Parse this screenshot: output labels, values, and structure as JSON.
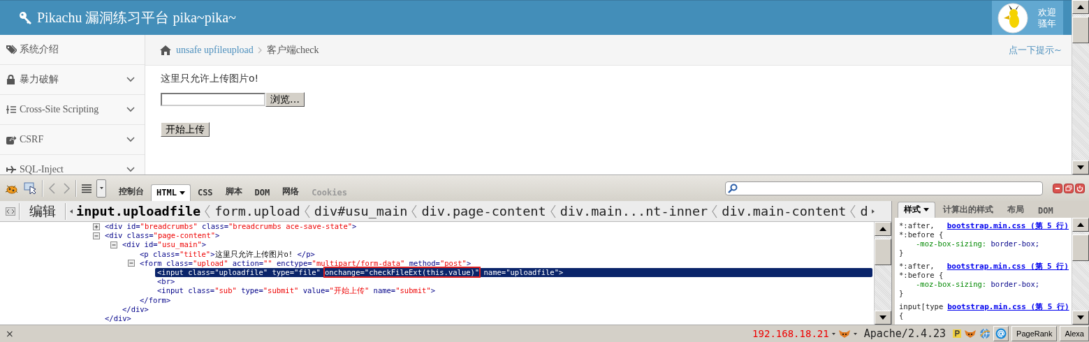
{
  "header": {
    "title": "Pikachu 漏洞练习平台 pika~pika~",
    "greeting": [
      "欢迎",
      "骚年"
    ]
  },
  "sidebar": {
    "items": [
      {
        "label": "系统介绍",
        "has_submenu": false
      },
      {
        "label": "暴力破解",
        "has_submenu": true
      },
      {
        "label": "Cross-Site Scripting",
        "has_submenu": true
      },
      {
        "label": "CSRF",
        "has_submenu": true
      },
      {
        "label": "SQL-Inject",
        "has_submenu": true
      }
    ]
  },
  "breadcrumb": {
    "items": [
      {
        "text": "unsafe upfileupload",
        "kind": "link"
      },
      {
        "text": "客户端check",
        "kind": "current"
      }
    ],
    "hint": "点一下提示~"
  },
  "content": {
    "title": "这里只允许上传图片o!",
    "browse_button": "浏览…",
    "submit_button": "开始上传"
  },
  "firebug": {
    "tabs": [
      {
        "label": "控制台",
        "selected": false,
        "disabled": false
      },
      {
        "label": "HTML",
        "selected": true,
        "disabled": false
      },
      {
        "label": "CSS",
        "selected": false,
        "disabled": false
      },
      {
        "label": "脚本",
        "selected": false,
        "disabled": false
      },
      {
        "label": "DOM",
        "selected": false,
        "disabled": false
      },
      {
        "label": "网络",
        "selected": false,
        "disabled": false
      },
      {
        "label": "Cookies",
        "selected": false,
        "disabled": true
      }
    ],
    "edit_button": "编辑",
    "path": [
      {
        "text": "input.uploadfile",
        "selected": true
      },
      {
        "text": "form.upload",
        "selected": false
      },
      {
        "text": "div#usu_main",
        "selected": false
      },
      {
        "text": "div.page-content",
        "selected": false
      },
      {
        "text": "div.main...nt-inner",
        "selected": false
      },
      {
        "text": "div.main-content",
        "selected": false
      },
      {
        "text": "d",
        "selected": false
      }
    ],
    "html_lines": [
      {
        "selected": false,
        "expanded": false,
        "tokens": [
          {
            "kind": "tag",
            "text": "<div"
          },
          {
            "kind": "attr",
            "text": " id="
          },
          {
            "kind": "value",
            "text": "\"breadcrumbs\""
          },
          {
            "kind": "attr",
            "text": " class="
          },
          {
            "kind": "value",
            "text": "\"breadcrumbs ace-save-state\""
          },
          {
            "kind": "tag",
            "text": ">"
          }
        ]
      },
      {
        "selected": false,
        "expanded": true,
        "tokens": [
          {
            "kind": "tag",
            "text": "<div"
          },
          {
            "kind": "attr",
            "text": " class="
          },
          {
            "kind": "value",
            "text": "\"page-content\""
          },
          {
            "kind": "tag",
            "text": ">"
          }
        ],
        "children": [
          {
            "selected": false,
            "expanded": true,
            "tokens": [
              {
                "kind": "tag",
                "text": "<div"
              },
              {
                "kind": "attr",
                "text": " id="
              },
              {
                "kind": "value",
                "text": "\"usu_main\""
              },
              {
                "kind": "tag",
                "text": ">"
              }
            ],
            "children": [
              {
                "selected": false,
                "tokens": [
                  {
                    "kind": "tag",
                    "text": "<p"
                  },
                  {
                    "kind": "attr",
                    "text": " class="
                  },
                  {
                    "kind": "value",
                    "text": "\"title\""
                  },
                  {
                    "kind": "tag",
                    "text": ">"
                  },
                  {
                    "kind": "text",
                    "text": "这里只允许上传图片o! "
                  },
                  {
                    "kind": "tag",
                    "text": "</p>"
                  }
                ]
              },
              {
                "selected": false,
                "expanded": true,
                "tokens": [
                  {
                    "kind": "tag",
                    "text": "<form"
                  },
                  {
                    "kind": "attr",
                    "text": " class="
                  },
                  {
                    "kind": "value",
                    "text": "\"upload\""
                  },
                  {
                    "kind": "attr",
                    "text": " action="
                  },
                  {
                    "kind": "value",
                    "text": "\"\""
                  },
                  {
                    "kind": "attr",
                    "text": " enctype="
                  },
                  {
                    "kind": "value",
                    "text": "\"multipart/form-data\""
                  },
                  {
                    "kind": "attr",
                    "text": " method="
                  },
                  {
                    "kind": "value",
                    "text": "\"post\""
                  },
                  {
                    "kind": "tag",
                    "text": ">"
                  }
                ],
                "children": [
                  {
                    "selected": true,
                    "tokens": [
                      {
                        "kind": "tag",
                        "text": "<input"
                      },
                      {
                        "kind": "attr",
                        "text": " class="
                      },
                      {
                        "kind": "value",
                        "text": "\"uploadfile\""
                      },
                      {
                        "kind": "attr",
                        "text": " type="
                      },
                      {
                        "kind": "value",
                        "text": "\"file\""
                      },
                      {
                        "kind": "boxed",
                        "text": "onchange=\"checkFileExt(this.value)\""
                      },
                      {
                        "kind": "attr",
                        "text": " name="
                      },
                      {
                        "kind": "value",
                        "text": "\"uploadfile\""
                      },
                      {
                        "kind": "tag",
                        "text": ">"
                      }
                    ]
                  },
                  {
                    "selected": false,
                    "tokens": [
                      {
                        "kind": "tag",
                        "text": "<br>"
                      }
                    ]
                  },
                  {
                    "selected": false,
                    "tokens": [
                      {
                        "kind": "tag",
                        "text": "<input"
                      },
                      {
                        "kind": "attr",
                        "text": " class="
                      },
                      {
                        "kind": "value",
                        "text": "\"sub\""
                      },
                      {
                        "kind": "attr",
                        "text": " type="
                      },
                      {
                        "kind": "value",
                        "text": "\"submit\""
                      },
                      {
                        "kind": "attr",
                        "text": " value="
                      },
                      {
                        "kind": "value",
                        "text": "\"开始上传\""
                      },
                      {
                        "kind": "attr",
                        "text": " name="
                      },
                      {
                        "kind": "value",
                        "text": "\"submit\""
                      },
                      {
                        "kind": "tag",
                        "text": ">"
                      }
                    ]
                  }
                ],
                "close": [
                  {
                    "kind": "tag",
                    "text": "</form>"
                  }
                ]
              }
            ],
            "close": [
              {
                "kind": "tag",
                "text": "</div>"
              }
            ]
          }
        ],
        "close": [
          {
            "kind": "tag",
            "text": "</div>"
          }
        ]
      }
    ],
    "side_tabs": [
      {
        "label": "样式",
        "selected": true
      },
      {
        "label": "计算出的样式",
        "selected": false
      },
      {
        "label": "布局",
        "selected": false
      },
      {
        "label": "DOM",
        "selected": false
      }
    ],
    "rules": [
      {
        "selectors": [
          "*:after,",
          "*:before {"
        ],
        "source": "bootstrap.min.css (第 5 行)",
        "declarations": [
          {
            "property": "-moz-box-sizing:",
            "value": "border-box;"
          }
        ],
        "close": "}"
      },
      {
        "selectors": [
          "*:after,",
          "*:before {"
        ],
        "source": "bootstrap.min.css (第 5 行)",
        "declarations": [
          {
            "property": "-moz-box-sizing:",
            "value": "border-box;"
          }
        ],
        "close": "}"
      },
      {
        "selectors": [
          "input[type",
          "{"
        ],
        "source": "bootstrap.min.css (第 5 行)"
      }
    ]
  },
  "status_bar": {
    "close": "×",
    "ip": "192.168.18.21",
    "server": "Apache/2.4.23",
    "buttons": [
      "PageRank",
      "Alexa"
    ]
  }
}
